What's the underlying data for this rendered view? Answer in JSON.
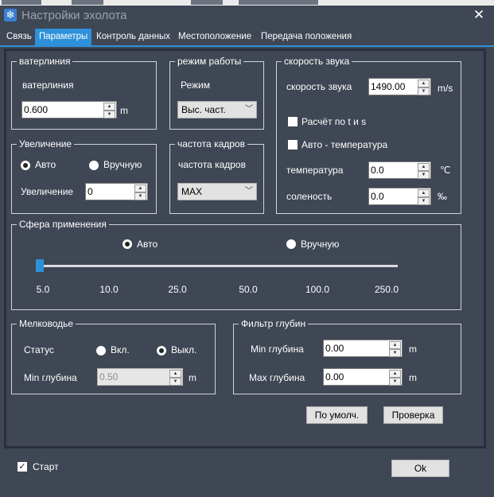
{
  "window": {
    "title": "Настройки эхолота",
    "close_glyph": "✕",
    "icon": "snowflake-icon"
  },
  "tabs": [
    "Связь",
    "Параметры",
    "Контроль данных",
    "Местоположение",
    "Передача положения"
  ],
  "active_tab": "Параметры",
  "waterline": {
    "group_title": "ватерлиния",
    "label": "ватерлиния",
    "value": "0.600",
    "unit": "m"
  },
  "work_mode": {
    "group_title": "режим работы",
    "label": "Режим",
    "value": "Выс. част."
  },
  "sound_speed": {
    "group_title": "скорость звука",
    "speed_label": "скорость звука",
    "speed_value": "1490.00",
    "speed_unit": "m/s",
    "calc_label": "Расчёт по t и s",
    "calc_checked": false,
    "auto_temp_label": "Авто - температура",
    "auto_temp_checked": false,
    "temp_label": "температура",
    "temp_value": "0.0",
    "temp_unit": "℃",
    "salinity_label": "соленость",
    "salinity_value": "0.0",
    "salinity_unit": "‰"
  },
  "gain": {
    "group_title": "Увеличение",
    "auto_label": "Авто",
    "manual_label": "Вручную",
    "selected": "Авто",
    "value_label": "Увеличение",
    "value": "0"
  },
  "frame_rate": {
    "group_title": "частота кадров",
    "label": "частота кадров",
    "value": "MAX"
  },
  "range": {
    "group_title": "Сфера применения",
    "auto_label": "Авто",
    "manual_label": "Вручную",
    "selected": "Авто",
    "ticks": [
      "5.0",
      "10.0",
      "25.0",
      "50.0",
      "100.0",
      "250.0"
    ],
    "slider_value": "5.0"
  },
  "shallow": {
    "group_title": "Мелководье",
    "status_label": "Статус",
    "on_label": "Вкл.",
    "off_label": "Выкл.",
    "selected": "Выкл.",
    "min_depth_label": "Min глубина",
    "min_depth_value": "0.50",
    "unit": "m"
  },
  "depth_filter": {
    "group_title": "Фильтр глубин",
    "min_label": "Min глубина",
    "min_value": "0.00",
    "max_label": "Max глубина",
    "max_value": "0.00",
    "unit": "m"
  },
  "buttons": {
    "defaults": "По умолч.",
    "check": "Проверка",
    "ok": "Ok"
  },
  "footer": {
    "start_label": "Старт",
    "start_checked": true
  },
  "colors": {
    "background": "#3f4654",
    "accent": "#2e90d9",
    "border": "#2b303a"
  }
}
